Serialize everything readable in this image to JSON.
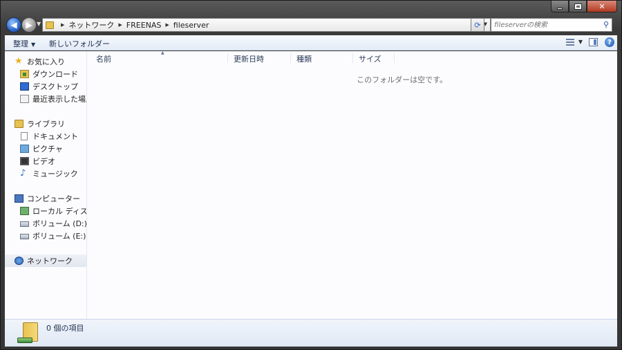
{
  "window": {
    "caption": {
      "minimize_icon": "minimize-icon",
      "maximize_icon": "maximize-icon",
      "close_icon": "close-icon"
    }
  },
  "address_bar": {
    "breadcrumbs": [
      "ネットワーク",
      "FREENAS",
      "fileserver"
    ],
    "search_placeholder": "fileserverの検索"
  },
  "toolbar": {
    "organize_label": "整理",
    "new_folder_label": "新しいフォルダー"
  },
  "nav_pane": {
    "favorites": {
      "label": "お気に入り",
      "items": [
        "ダウンロード",
        "デスクトップ",
        "最近表示した場所"
      ]
    },
    "libraries": {
      "label": "ライブラリ",
      "items": [
        "ドキュメント",
        "ピクチャ",
        "ビデオ",
        "ミュージック"
      ]
    },
    "computer": {
      "label": "コンピューター",
      "items": [
        "ローカル ディスク (",
        "ボリューム (D:)",
        "ボリューム (E:)"
      ]
    },
    "network": {
      "label": "ネットワーク"
    }
  },
  "file_list": {
    "columns": [
      "名前",
      "更新日時",
      "種類",
      "サイズ"
    ],
    "empty_message": "このフォルダーは空です。"
  },
  "status_bar": {
    "item_count": "0 個の項目"
  }
}
